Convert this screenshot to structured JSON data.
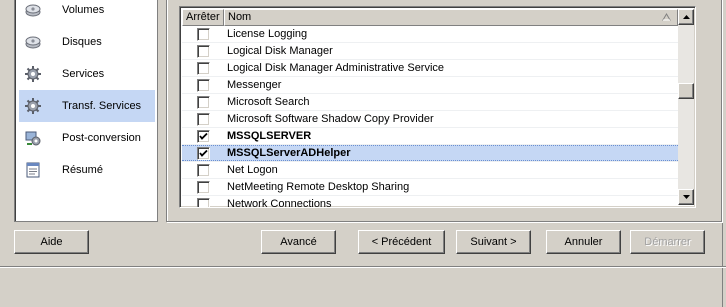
{
  "sidebar": {
    "items": [
      {
        "label": "Volumes",
        "icon": "volume-gear-icon",
        "selected": false
      },
      {
        "label": "Disques",
        "icon": "disk-gear-icon",
        "selected": false
      },
      {
        "label": "Services",
        "icon": "services-gear-icon",
        "selected": false
      },
      {
        "label": "Transf. Services",
        "icon": "transfer-gear-icon",
        "selected": true
      },
      {
        "label": "Post-conversion",
        "icon": "post-conversion-icon",
        "selected": false
      },
      {
        "label": "Résumé",
        "icon": "summary-document-icon",
        "selected": false
      }
    ]
  },
  "services_list": {
    "headers": {
      "stop": "Arrêter",
      "name": "Nom"
    },
    "rows": [
      {
        "name": "License Logging",
        "checked": false,
        "bold": false,
        "highlight": false
      },
      {
        "name": "Logical Disk Manager",
        "checked": false,
        "bold": false,
        "highlight": false
      },
      {
        "name": "Logical Disk Manager Administrative Service",
        "checked": false,
        "bold": false,
        "highlight": false
      },
      {
        "name": "Messenger",
        "checked": false,
        "bold": false,
        "highlight": false
      },
      {
        "name": "Microsoft Search",
        "checked": false,
        "bold": false,
        "highlight": false
      },
      {
        "name": "Microsoft Software Shadow Copy Provider",
        "checked": false,
        "bold": false,
        "highlight": false
      },
      {
        "name": "MSSQLSERVER",
        "checked": true,
        "bold": true,
        "highlight": false
      },
      {
        "name": "MSSQLServerADHelper",
        "checked": true,
        "bold": true,
        "highlight": true
      },
      {
        "name": "Net Logon",
        "checked": false,
        "bold": false,
        "highlight": false
      },
      {
        "name": "NetMeeting Remote Desktop Sharing",
        "checked": false,
        "bold": false,
        "highlight": false
      },
      {
        "name": "Network Connections",
        "checked": false,
        "bold": false,
        "highlight": false
      }
    ]
  },
  "buttons": {
    "help": "Aide",
    "advanced": "Avancé",
    "previous": "< Précédent",
    "next": "Suivant >",
    "cancel": "Annuler",
    "start": "Démarrer"
  },
  "colors": {
    "selection": "#c5d7f4",
    "window_bg": "#d4d0c8"
  }
}
